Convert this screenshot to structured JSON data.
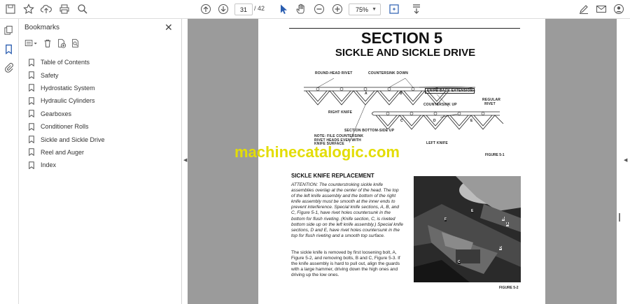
{
  "toolbar": {
    "page_current": "31",
    "page_total": "/ 42",
    "zoom": "75%"
  },
  "panel": {
    "title": "Bookmarks",
    "items": [
      "Table of Contents",
      "Safety",
      "Hydrostatic System",
      "Hydraulic Cylinders",
      "Gearboxes",
      "Conditioner Rolls",
      "Sickle and Sickle Drive",
      "Reel and Auger",
      "Index"
    ]
  },
  "doc": {
    "section": "SECTION 5",
    "section_title": "SICKLE AND SICKLE DRIVE",
    "fig1_labels": {
      "round_head_rivet": "ROUND-HEAD RIVET",
      "countersink_down": "COUNTERSINK DOWN",
      "knife_back_extension": "KNIFE-BACK EXTENSION",
      "regular_rivet": "REGULAR RIVET",
      "countersink_up": "COUNTERSINK UP",
      "right_knife": "RIGHT KNIFE",
      "section_bottom_side_up": "SECTION BOTTOM-SIDE UP",
      "note": "NOTE: FILE COUNTERSINK RIVET HEADS EVEN WITH KNIFE SURFACE",
      "left_knife": "LEFT KNIFE",
      "a": "A",
      "b": "B",
      "c": "C",
      "d": "D",
      "e": "E"
    },
    "figure1_caption": "FIGURE 5-1",
    "subhead": "SICKLE KNIFE REPLACEMENT",
    "attention_text": "ATTENTION: The counterstroking sickle knife assemblies overlap at the center of the head. The top of the left knife assembly and the bottom of the right knife assembly must be smooth at the inner ends to prevent interference. Special knife sections, A, B, and C, Figure 5-1, have rivet holes countersunk in the bottom for flush riveting. (Knife section, C, is riveted bottom side up on the left knife assembly.) Special knife sections, D and E, have rivet holes countersunk in the top for flush riveting and a smooth top surface.",
    "body_text": "The sickle knife is removed by first loosening bolt, A, Figure 5-2, and removing bolts, B and C, Figure 5-3. If the knife assembly is hard to pull out, align the guards with a large hammer, driving down the high ones and driving up the low ones.",
    "photo_labels": [
      "F",
      "B",
      "A",
      "E",
      "D",
      "C"
    ],
    "figure2_caption": "FIGURE 5-2"
  },
  "watermark": "machinecatalogic.com"
}
